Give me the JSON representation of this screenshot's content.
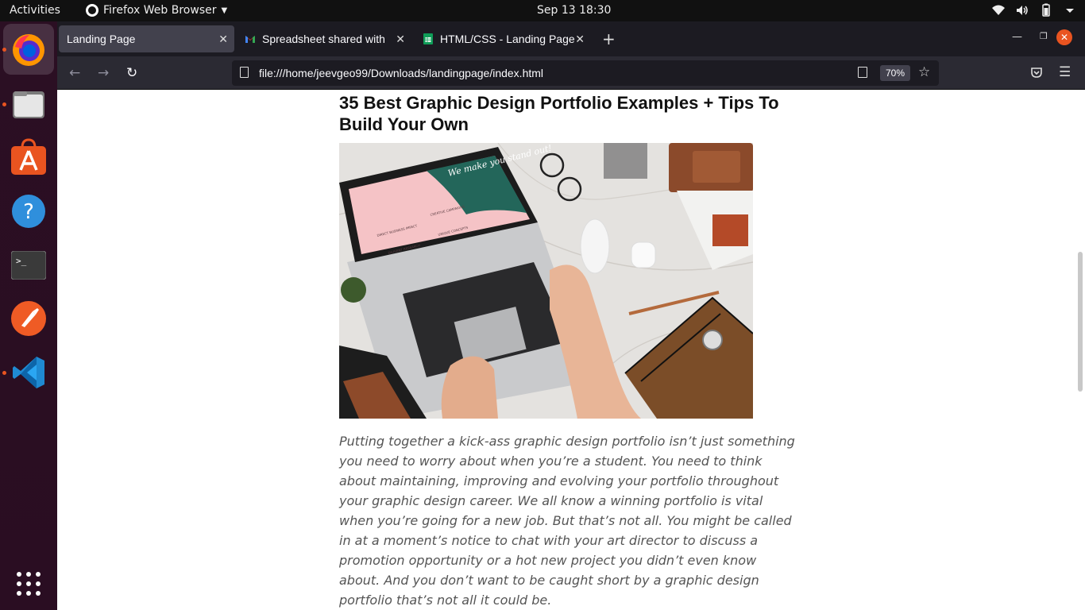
{
  "topbar": {
    "activities": "Activities",
    "app_name": "Firefox Web Browser",
    "clock": "Sep 13  18:30",
    "icons": [
      "wifi-icon",
      "volume-icon",
      "battery-icon",
      "power-caret-icon"
    ]
  },
  "dock": {
    "items": [
      {
        "name": "firefox",
        "icon": "firefox-icon",
        "active": true
      },
      {
        "name": "files",
        "icon": "files-icon",
        "active": false
      },
      {
        "name": "software",
        "icon": "app-store-icon",
        "active": false
      },
      {
        "name": "help",
        "icon": "help-icon",
        "active": false
      },
      {
        "name": "terminal",
        "icon": "terminal-icon",
        "active": false
      },
      {
        "name": "postman",
        "icon": "postman-icon",
        "active": false
      },
      {
        "name": "vscode",
        "icon": "vscode-icon",
        "active": false
      },
      {
        "name": "app-grid",
        "icon": "app-grid-icon",
        "active": false
      }
    ]
  },
  "tabs": [
    {
      "label": "Landing Page",
      "active": true
    },
    {
      "label": "Spreadsheet shared with",
      "active": false,
      "icon": "gmail-icon"
    },
    {
      "label": "HTML/CSS - Landing Page",
      "active": false,
      "icon": "sheets-icon"
    }
  ],
  "navbar": {
    "url": "file:///home/jeevgeo99/Downloads/landingpage/index.html",
    "zoom": "70%"
  },
  "article": {
    "title": "35 Best Graphic Design Portfolio Examples + Tips To Build Your Own",
    "image_screen_text": [
      "We make you stand out!",
      "DIRECT BUSINESS IMPACT",
      "CREATIVE CAMPAIGNS",
      "DILIGENT RESEARCH",
      "UNIQUE CONCEPTS"
    ],
    "body": "Putting together a kick-ass graphic design portfolio isn’t just something you need to worry about when you’re a student. You need to think about maintaining, improving and evolving your portfolio throughout your graphic design career. We all know a winning portfolio is vital when you’re going for a new job. But that’s not all. You might be called in at a moment’s notice to chat with your art director to discuss a promotion opportunity or a hot new project you didn’t even know about. And you don’t want to be caught short by a graphic design portfolio that’s not all it could be."
  },
  "colors": {
    "ubuntu_orange": "#e95420",
    "tab_active": "#42414d",
    "toolbar": "#2b2a33"
  }
}
